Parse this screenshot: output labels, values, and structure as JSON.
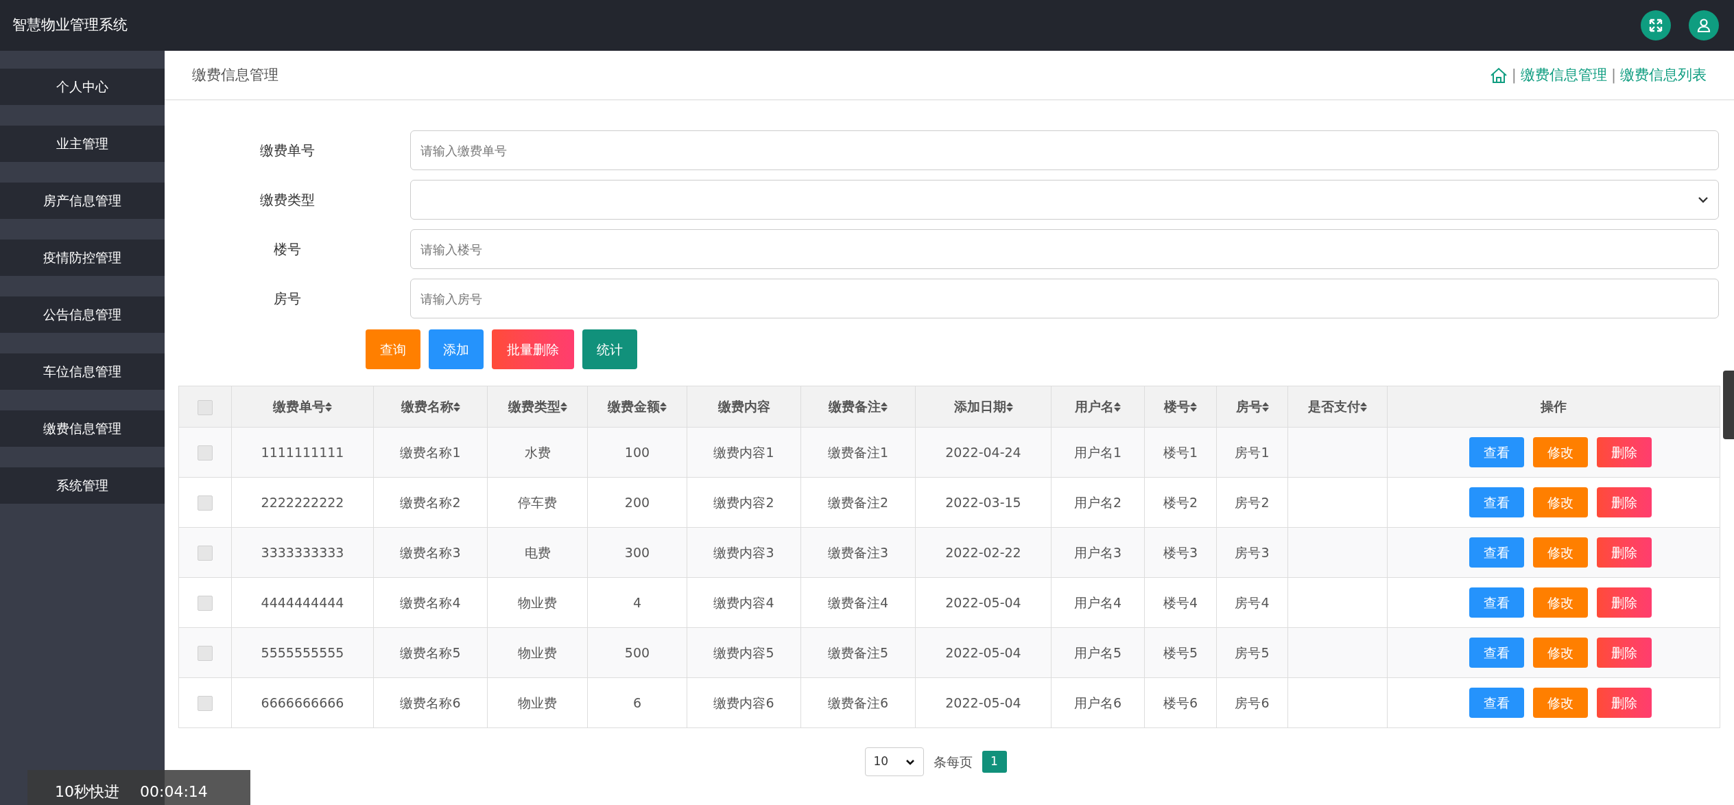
{
  "app": {
    "title": "智慧物业管理系统"
  },
  "sidebar": {
    "items": [
      {
        "label": "个人中心",
        "selected": false
      },
      {
        "label": "业主管理",
        "selected": false
      },
      {
        "label": "房产信息管理",
        "selected": false
      },
      {
        "label": "疫情防控管理",
        "selected": false
      },
      {
        "label": "公告信息管理",
        "selected": false
      },
      {
        "label": "车位信息管理",
        "selected": false
      },
      {
        "label": "缴费信息管理",
        "selected": false
      },
      {
        "label": "系统管理",
        "selected": false
      }
    ]
  },
  "page_header": {
    "title": "缴费信息管理",
    "breadcrumb": [
      {
        "separator": "|",
        "label": "缴费信息管理"
      },
      {
        "separator": "|",
        "label": "缴费信息列表"
      }
    ]
  },
  "search_form": {
    "fields": [
      {
        "label": "缴费单号",
        "kind": "input",
        "placeholder": "请输入缴费单号"
      },
      {
        "label": "缴费类型",
        "kind": "select"
      },
      {
        "label": "楼号",
        "kind": "input",
        "placeholder": "请输入楼号"
      },
      {
        "label": "房号",
        "kind": "input",
        "placeholder": "请输入房号"
      }
    ],
    "buttons": [
      {
        "label": "查询",
        "kind": "query"
      },
      {
        "label": "添加",
        "kind": "add"
      },
      {
        "label": "批量删除",
        "kind": "delete"
      },
      {
        "label": "统计",
        "kind": "stats"
      }
    ]
  },
  "table": {
    "header_checked": false,
    "columns": [
      {
        "label": "缴费单号",
        "sortable": true
      },
      {
        "label": "缴费名称",
        "sortable": true
      },
      {
        "label": "缴费类型",
        "sortable": true
      },
      {
        "label": "缴费金额",
        "sortable": true
      },
      {
        "label": "缴费内容",
        "sortable": false
      },
      {
        "label": "缴费备注",
        "sortable": true
      },
      {
        "label": "添加日期",
        "sortable": true
      },
      {
        "label": "用户名",
        "sortable": true
      },
      {
        "label": "楼号",
        "sortable": true
      },
      {
        "label": "房号",
        "sortable": true
      },
      {
        "label": "是否支付",
        "sortable": true
      },
      {
        "label": "操作",
        "sortable": false
      }
    ],
    "rows": [
      {
        "checked": false,
        "cells": [
          "1111111111",
          "缴费名称1",
          "水费",
          "100",
          "缴费内容1",
          "缴费备注1",
          "2022-04-24",
          "用户名1",
          "楼号1",
          "房号1",
          ""
        ],
        "actions": [
          "查看",
          "修改",
          "删除"
        ]
      },
      {
        "checked": false,
        "cells": [
          "2222222222",
          "缴费名称2",
          "停车费",
          "200",
          "缴费内容2",
          "缴费备注2",
          "2022-03-15",
          "用户名2",
          "楼号2",
          "房号2",
          ""
        ],
        "actions": [
          "查看",
          "修改",
          "删除"
        ]
      },
      {
        "checked": false,
        "cells": [
          "3333333333",
          "缴费名称3",
          "电费",
          "300",
          "缴费内容3",
          "缴费备注3",
          "2022-02-22",
          "用户名3",
          "楼号3",
          "房号3",
          ""
        ],
        "actions": [
          "查看",
          "修改",
          "删除"
        ]
      },
      {
        "checked": false,
        "cells": [
          "4444444444",
          "缴费名称4",
          "物业费",
          "4",
          "缴费内容4",
          "缴费备注4",
          "2022-05-04",
          "用户名4",
          "楼号4",
          "房号4",
          ""
        ],
        "actions": [
          "查看",
          "修改",
          "删除"
        ]
      },
      {
        "checked": false,
        "cells": [
          "5555555555",
          "缴费名称5",
          "物业费",
          "500",
          "缴费内容5",
          "缴费备注5",
          "2022-05-04",
          "用户名5",
          "楼号5",
          "房号5",
          ""
        ],
        "actions": [
          "查看",
          "修改",
          "删除"
        ]
      },
      {
        "checked": false,
        "cells": [
          "6666666666",
          "缴费名称6",
          "物业费",
          "6",
          "缴费内容6",
          "缴费备注6",
          "2022-05-04",
          "用户名6",
          "楼号6",
          "房号6",
          ""
        ],
        "actions": [
          "查看",
          "修改",
          "删除"
        ]
      }
    ]
  },
  "pagination": {
    "page_size": "10",
    "per_page_label": "条每页",
    "pages": [
      {
        "label": "1",
        "selected": true
      }
    ]
  },
  "video_overlay": {
    "skip_label": "10秒快进",
    "time": "00:04:14"
  }
}
